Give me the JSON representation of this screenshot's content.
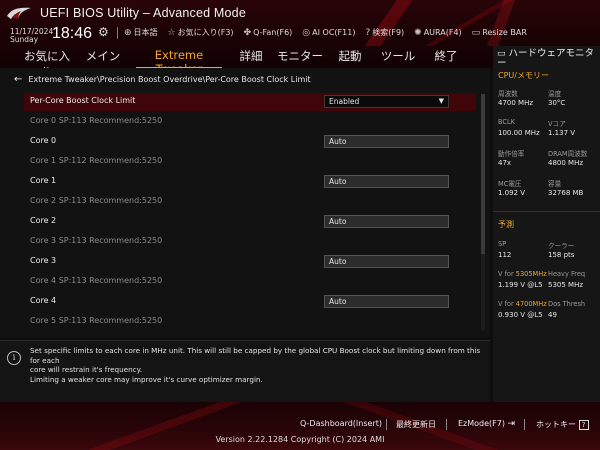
{
  "header": {
    "title": "UEFI BIOS Utility – Advanced Mode",
    "date": "11/17/2024",
    "day": "Sunday",
    "time": "18:46",
    "tools": [
      {
        "icon": "globe-icon",
        "glyph": "⊕",
        "label": "日本語"
      },
      {
        "icon": "star-icon",
        "glyph": "☆",
        "label": "お気に入り(F3)"
      },
      {
        "icon": "fan-icon",
        "glyph": "✤",
        "label": "Q-Fan(F6)"
      },
      {
        "icon": "ai-icon",
        "glyph": "◎",
        "label": "AI OC(F11)"
      },
      {
        "icon": "search-icon",
        "glyph": "?",
        "label": "検索(F9)"
      },
      {
        "icon": "aura-icon",
        "glyph": "✺",
        "label": "AURA(F4)"
      },
      {
        "icon": "resize-icon",
        "glyph": "▭",
        "label": "Resize BAR"
      }
    ]
  },
  "menu": [
    {
      "label": "お気に入り",
      "active": false
    },
    {
      "label": "メイン",
      "active": false
    },
    {
      "label": "Extreme Tweaker",
      "active": true
    },
    {
      "label": "詳細",
      "active": false
    },
    {
      "label": "モニター",
      "active": false
    },
    {
      "label": "起動",
      "active": false
    },
    {
      "label": "ツール",
      "active": false
    },
    {
      "label": "終了",
      "active": false
    }
  ],
  "breadcrumb": "Extreme Tweaker\\Precision Boost Overdrive\\Per-Core Boost Clock Limit",
  "settings": {
    "limit_label": "Per-Core Boost Clock Limit",
    "limit_value": "Enabled",
    "cores": [
      {
        "info": "Core 0  SP:113  Recommend:5250",
        "label": "Core 0",
        "value": "Auto"
      },
      {
        "info": "Core 1  SP:112  Recommend:5250",
        "label": "Core 1",
        "value": "Auto"
      },
      {
        "info": "Core 2  SP:113  Recommend:5250",
        "label": "Core 2",
        "value": "Auto"
      },
      {
        "info": "Core 3  SP:113  Recommend:5250",
        "label": "Core 3",
        "value": "Auto"
      },
      {
        "info": "Core 4  SP:113  Recommend:5250",
        "label": "Core 4",
        "value": "Auto"
      },
      {
        "info": "Core 5  SP:113  Recommend:5250"
      }
    ]
  },
  "help": {
    "line1": "Set specific limits to each core in MHz unit. This will still be capped by the global CPU Boost clock but limiting down from this for each",
    "line2": "core will restrain it's frequency.",
    "line3": "Limiting a weaker core may improve it's curve optimizer margin."
  },
  "hardware_monitor": {
    "title": "ハードウェアモニター",
    "cpu_section": "CPU/メモリー",
    "cpu": [
      {
        "label": "周波数",
        "value": "4700 MHz",
        "label2": "温度",
        "value2": "30°C"
      },
      {
        "label": "BCLK",
        "value": "100.00 MHz",
        "label2": "Vコア",
        "value2": "1.137 V"
      },
      {
        "label": "動作倍率",
        "value": "47x",
        "label2": "DRAM周波数",
        "value2": "4800 MHz"
      },
      {
        "label": "MC電圧",
        "value": "1.092 V",
        "label2": "容量",
        "value2": "32768 MB"
      }
    ],
    "predict_section": "予測",
    "predict": {
      "sp_label": "SP",
      "sp_value": "112",
      "cooler_label": "クーラー",
      "cooler_value": "158 pts",
      "vfor1_prefix": "V for ",
      "vfor1_freq": "5305MHz",
      "vfor1_value": "1.199 V @L5",
      "heavy_label": "Heavy Freq",
      "heavy_value": "5305 MHz",
      "vfor2_prefix": "V for ",
      "vfor2_freq": "4700MHz",
      "vfor2_value": "0.930 V @L5",
      "dos_label": "Dos Thresh",
      "dos_value": "49"
    }
  },
  "footer": {
    "qdashboard": "Q-Dashboard(Insert)",
    "last_modified": "最終更新日",
    "ezmode": "EzMode(F7)",
    "hotkey": "ホットキー",
    "version": "Version 2.22.1284 Copyright (C) 2024 AMI"
  },
  "colors": {
    "accent": "#f5a623",
    "header_red": "#2a0508",
    "selected_row": "#400508"
  }
}
